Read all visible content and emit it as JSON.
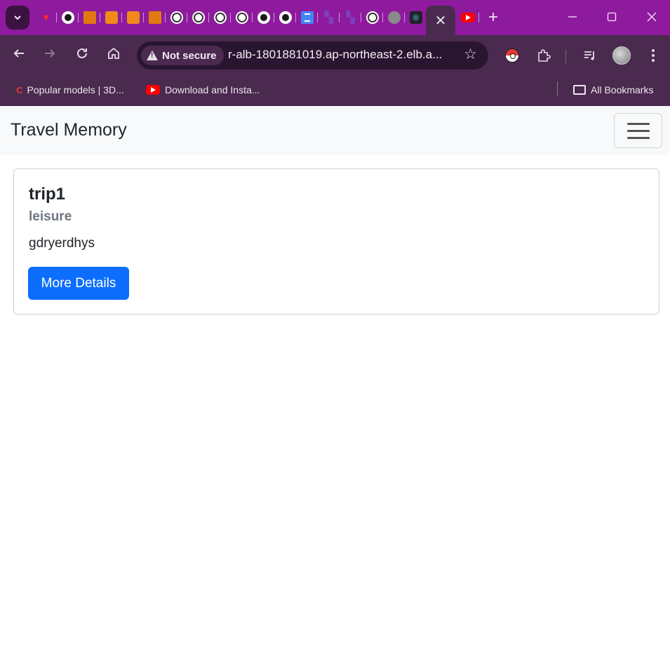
{
  "browser": {
    "pinned_tabs": [
      {
        "icon": "vercel-icon"
      },
      {
        "icon": "github-icon"
      },
      {
        "icon": "aws-icon"
      },
      {
        "icon": "aws-icon"
      },
      {
        "icon": "aws-icon"
      },
      {
        "icon": "aws-icon"
      },
      {
        "icon": "openai-icon"
      },
      {
        "icon": "openai-icon"
      },
      {
        "icon": "openai-icon"
      },
      {
        "icon": "openai-icon"
      },
      {
        "icon": "github-icon"
      },
      {
        "icon": "github-icon"
      },
      {
        "icon": "docs-icon"
      },
      {
        "icon": "terraform-icon"
      },
      {
        "icon": "terraform-icon"
      },
      {
        "icon": "openai-icon"
      },
      {
        "icon": "globe-icon"
      },
      {
        "icon": "react-icon"
      }
    ],
    "active_tab_close_glyph": "✕",
    "new_tab_glyph": "+",
    "security_label": "Not secure",
    "url": "r-alb-1801881019.ap-northeast-2.elb.a...",
    "bookmarks": [
      {
        "label": "Popular models | 3D..."
      },
      {
        "label": "Download and Insta..."
      }
    ],
    "all_bookmarks_label": "All Bookmarks",
    "theme_color": "#8e1a9e",
    "toolbar_color": "#4a2a4f"
  },
  "navbar": {
    "brand": "Travel Memory"
  },
  "trips": [
    {
      "title": "trip1",
      "type": "leisure",
      "description": "gdryerdhys",
      "button_label": "More Details"
    }
  ],
  "colors": {
    "primary_button": "#0d6efd",
    "navbar_bg": "#f8f9fa"
  }
}
